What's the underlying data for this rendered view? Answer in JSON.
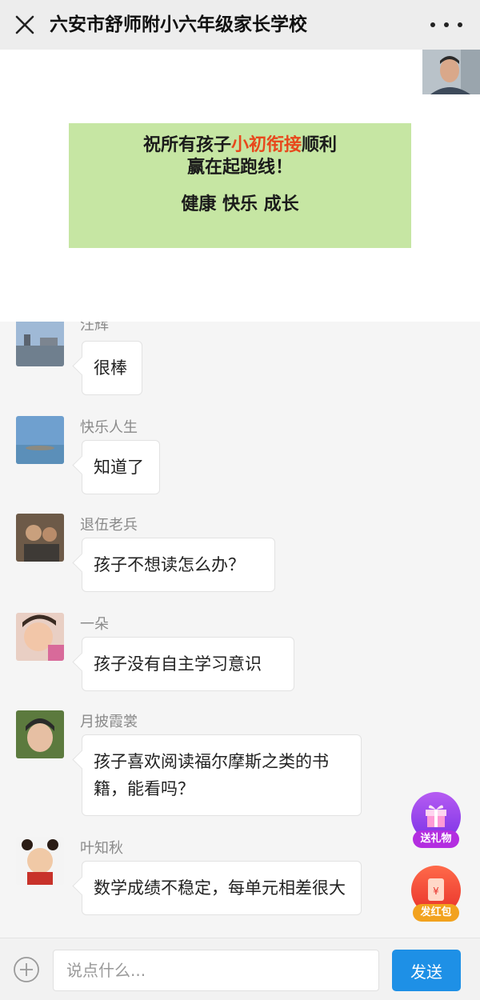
{
  "header": {
    "title": "六安市舒师附小六年级家长学校"
  },
  "slide": {
    "line1_before": "祝所有孩子",
    "line1_highlight": "小初衔接",
    "line1_after": "顺利",
    "line2": "赢在起跑线！",
    "line3": "健康 快乐 成长"
  },
  "messages": [
    {
      "name": "汪辉",
      "text": "很棒"
    },
    {
      "name": "快乐人生",
      "text": "知道了"
    },
    {
      "name": "退伍老兵",
      "text": "孩子不想读怎么办？"
    },
    {
      "name": "一朵",
      "text": "孩子没有自主学习意识"
    },
    {
      "name": "月披霞裳",
      "text": "孩子喜欢阅读福尔摩斯之类的书籍，能看吗？"
    },
    {
      "name": "叶知秋",
      "text": "数学成绩不稳定，每单元相差很大"
    }
  ],
  "fabs": {
    "gift_label": "送礼物",
    "redpacket_label": "发红包",
    "redpacket_symbol": "¥"
  },
  "input": {
    "placeholder": "说点什么..."
  },
  "send": {
    "label": "发送"
  }
}
